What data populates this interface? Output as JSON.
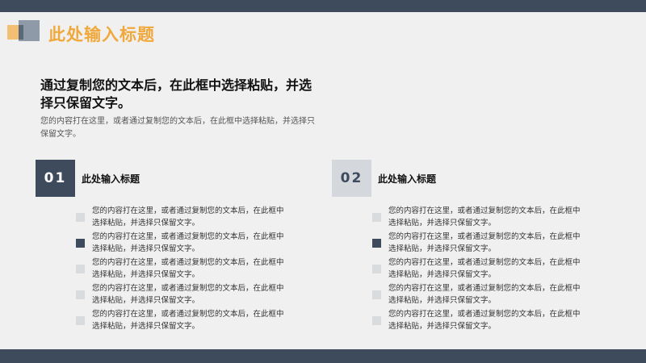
{
  "header": {
    "title": "此处输入标题"
  },
  "main": {
    "headline": "通过复制您的文本后，在此框中选择粘贴，并选择只保留文字。",
    "intro": "您的内容打在这里，或者通过复制您的文本后，在此框中选择粘贴，并选择只保留文字。"
  },
  "sections": [
    {
      "number": "01",
      "title": "此处输入标题",
      "items": [
        "您的内容打在这里，或者通过复制您的文本后，在此框中选择粘贴，并选择只保留文字。",
        "您的内容打在这里，或者通过复制您的文本后，在此框中选择粘贴，并选择只保留文字。",
        "您的内容打在这里，或者通过复制您的文本后，在此框中选择粘贴，并选择只保留文字。",
        "您的内容打在这里，或者通过复制您的文本后，在此框中选择粘贴，并选择只保留文字。",
        "您的内容打在这里，或者通过复制您的文本后，在此框中选择粘贴，并选择只保留文字。"
      ]
    },
    {
      "number": "02",
      "title": "此处输入标题",
      "items": [
        "您的内容打在这里，或者通过复制您的文本后，在此框中选择粘贴，并选择只保留文字。",
        "您的内容打在这里，或者通过复制您的文本后，在此框中选择粘贴，并选择只保留文字。",
        "您的内容打在这里，或者通过复制您的文本后，在此框中选择粘贴，并选择只保留文字。",
        "您的内容打在这里，或者通过复制您的文本后，在此框中选择粘贴，并选择只保留文字。",
        "您的内容打在这里，或者通过复制您的文本后，在此框中选择粘贴，并选择只保留文字。"
      ]
    }
  ],
  "colors": {
    "primary": "#3d4b5c",
    "accent": "#f0a83a",
    "light": "#d4d8dd"
  }
}
